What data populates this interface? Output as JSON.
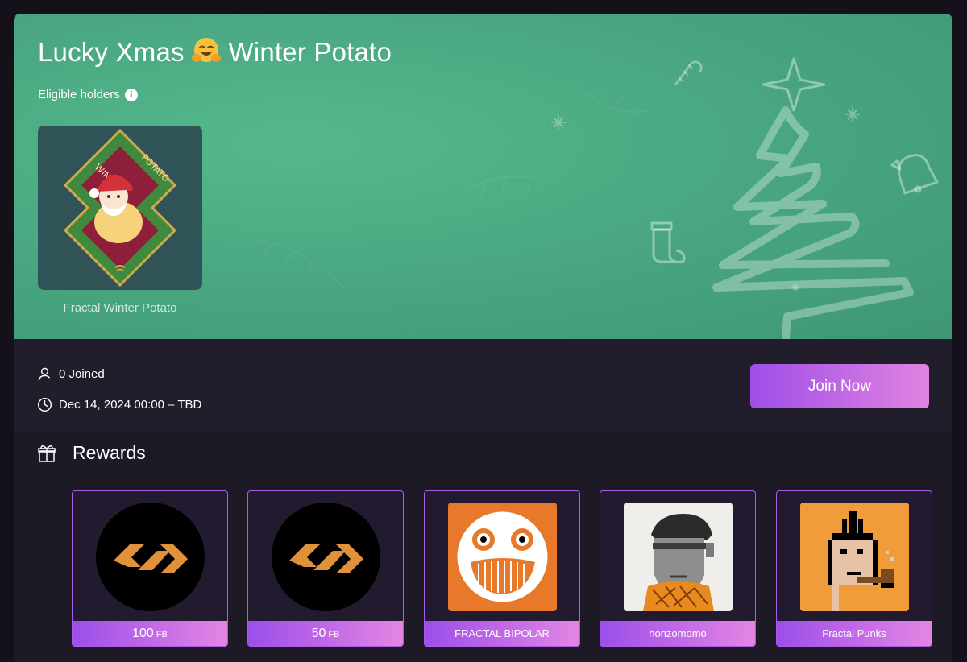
{
  "event": {
    "title": "Lucky Xmas",
    "title_emoji": "🤗",
    "title_suffix": "Winter Potato",
    "eligible_label": "Eligible holders",
    "nft_name": "Fractal Winter Potato",
    "nft_art_text_left": "WINTER",
    "nft_art_text_right": "POTATO"
  },
  "meta": {
    "joined": "0 Joined",
    "schedule": "Dec 14, 2024 00:00 – TBD",
    "join_label": "Join Now"
  },
  "rewards": {
    "title": "Rewards",
    "items": [
      {
        "amount": "100",
        "unit": "FB",
        "icon": "fractal-logo-icon"
      },
      {
        "amount": "50",
        "unit": "FB",
        "icon": "fractal-logo-icon"
      },
      {
        "name": "FRACTAL BIPOLAR",
        "icon": "bipolar-face-art"
      },
      {
        "name": "honzomomo",
        "icon": "honzomomo-portrait-art"
      },
      {
        "name": "Fractal Punks",
        "icon": "pixel-punk-art"
      }
    ]
  },
  "colors": {
    "hero_bg": "#4aa882",
    "accent_purple": "#9b4fea",
    "accent_pink": "#e286e4",
    "page_bg": "#14111b",
    "fractal_orange": "#e0913a"
  }
}
